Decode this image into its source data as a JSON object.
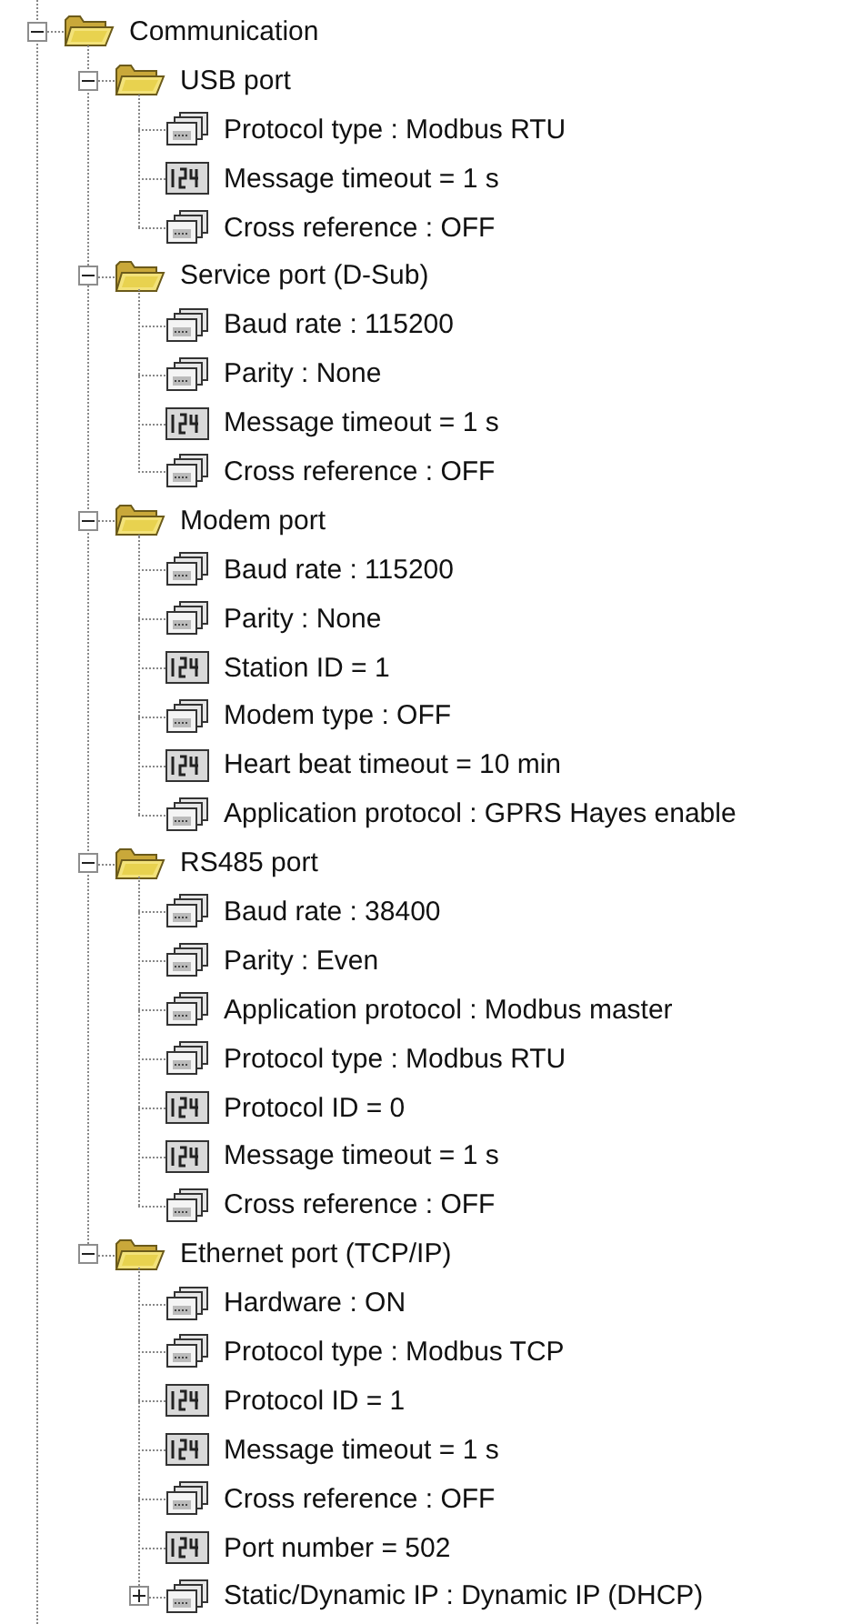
{
  "tree": [
    {
      "label": "Communication",
      "kind": "folder",
      "expanded": true,
      "children": [
        {
          "label": "USB port",
          "kind": "folder",
          "expanded": true,
          "children": [
            {
              "label": "Protocol type : Modbus RTU",
              "kind": "list"
            },
            {
              "label": "Message timeout = 1 s",
              "kind": "numeric"
            },
            {
              "label": "Cross reference : OFF",
              "kind": "list"
            }
          ]
        },
        {
          "label": "Service port (D-Sub)",
          "kind": "folder",
          "expanded": true,
          "children": [
            {
              "label": "Baud rate : 115200",
              "kind": "list"
            },
            {
              "label": "Parity : None",
              "kind": "list"
            },
            {
              "label": "Message timeout = 1 s",
              "kind": "numeric"
            },
            {
              "label": "Cross reference : OFF",
              "kind": "list"
            }
          ]
        },
        {
          "label": "Modem port",
          "kind": "folder",
          "expanded": true,
          "children": [
            {
              "label": "Baud rate : 115200",
              "kind": "list"
            },
            {
              "label": "Parity : None",
              "kind": "list"
            },
            {
              "label": "Station ID = 1",
              "kind": "numeric"
            },
            {
              "label": "Modem type : OFF",
              "kind": "list"
            },
            {
              "label": "Heart beat timeout = 10 min",
              "kind": "numeric"
            },
            {
              "label": "Application protocol : GPRS Hayes enable",
              "kind": "list"
            }
          ]
        },
        {
          "label": "RS485 port",
          "kind": "folder",
          "expanded": true,
          "children": [
            {
              "label": "Baud rate : 38400",
              "kind": "list"
            },
            {
              "label": "Parity : Even",
              "kind": "list"
            },
            {
              "label": "Application protocol : Modbus master",
              "kind": "list"
            },
            {
              "label": "Protocol type : Modbus RTU",
              "kind": "list"
            },
            {
              "label": "Protocol ID = 0",
              "kind": "numeric"
            },
            {
              "label": "Message timeout = 1 s",
              "kind": "numeric"
            },
            {
              "label": "Cross reference : OFF",
              "kind": "list"
            }
          ]
        },
        {
          "label": "Ethernet port (TCP/IP)",
          "kind": "folder",
          "expanded": true,
          "children": [
            {
              "label": "Hardware : ON",
              "kind": "list"
            },
            {
              "label": "Protocol type : Modbus TCP",
              "kind": "list"
            },
            {
              "label": "Protocol ID = 1",
              "kind": "numeric"
            },
            {
              "label": "Message timeout = 1 s",
              "kind": "numeric"
            },
            {
              "label": "Cross reference : OFF",
              "kind": "list"
            },
            {
              "label": "Port number = 502",
              "kind": "numeric"
            },
            {
              "label": "Static/Dynamic IP : Dynamic IP (DHCP)",
              "kind": "list",
              "expanded": false
            }
          ]
        }
      ]
    }
  ]
}
